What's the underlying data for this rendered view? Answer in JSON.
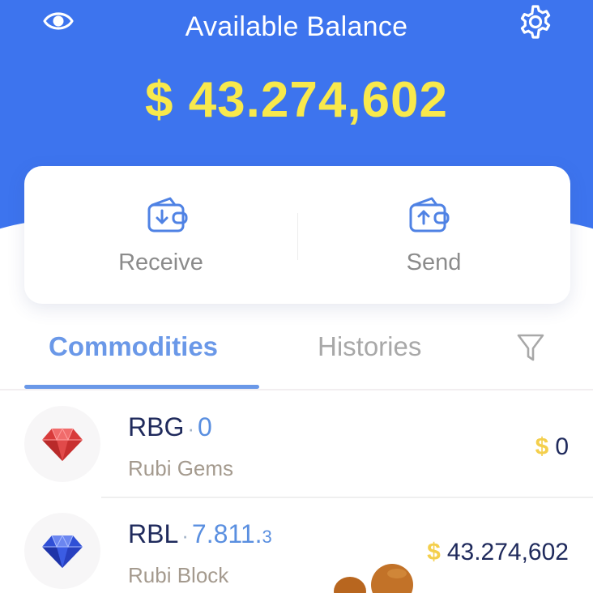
{
  "header": {
    "title": "Available Balance",
    "balance": "$ 43.274,602",
    "eye_icon": "eye-icon",
    "settings_icon": "gear-icon"
  },
  "actions": [
    {
      "label": "Receive",
      "icon": "wallet-receive-icon"
    },
    {
      "label": "Send",
      "icon": "wallet-send-icon"
    }
  ],
  "tabs": {
    "active": "Commodities",
    "inactive": "Histories",
    "filter_icon": "filter-icon"
  },
  "assets": [
    {
      "symbol": "RBG",
      "separator": "·",
      "quantity": "0",
      "quantity_small": "",
      "name": "Rubi Gems",
      "currency": "$",
      "value": "0",
      "icon": "red-gem-icon"
    },
    {
      "symbol": "RBL",
      "separator": "·",
      "quantity": "7.811.",
      "quantity_small": "3",
      "name": "Rubi Block",
      "currency": "$",
      "value": "43.274,602",
      "icon": "blue-gem-icon"
    }
  ],
  "colors": {
    "header_bg": "#3d74ee",
    "balance": "#f8e94c",
    "accent": "#6a98e8",
    "currency": "#f4cf4c"
  }
}
